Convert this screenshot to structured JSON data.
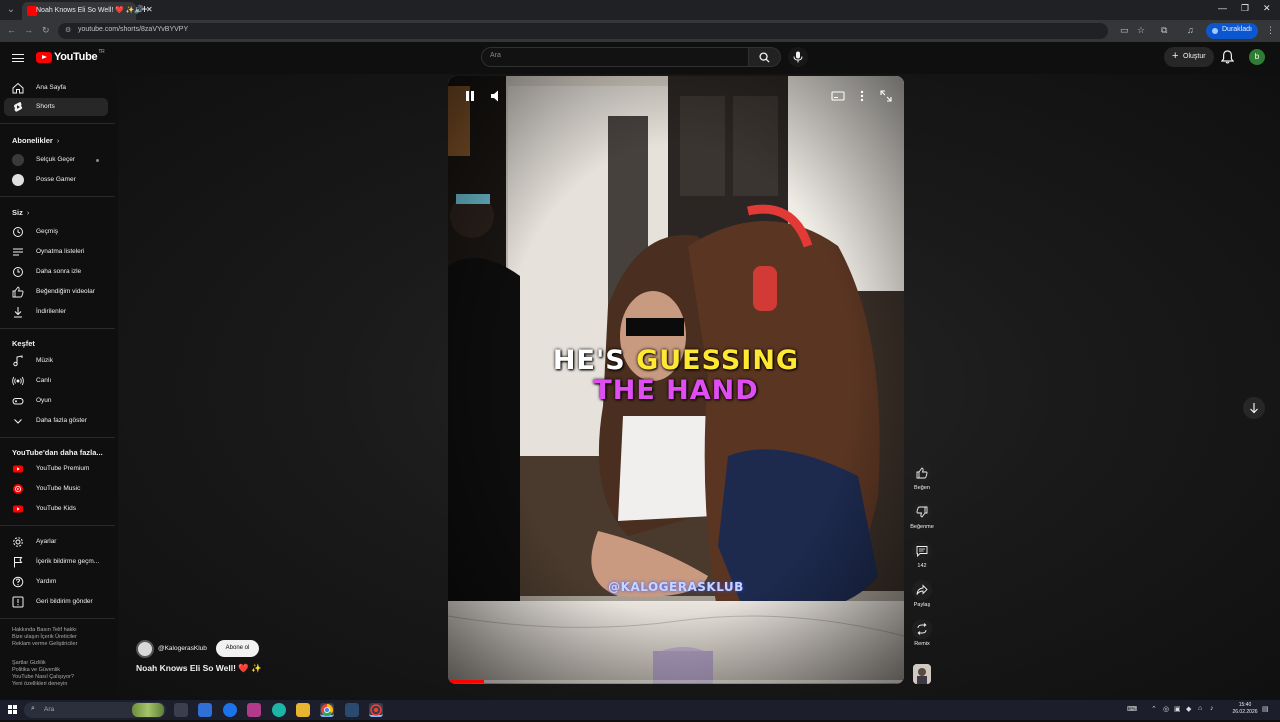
{
  "browser": {
    "tab_title": "Noah Knows Eli So Well! ❤️ ✨",
    "tab_audio_icon": "speaker-icon",
    "url": "youtube.com/shorts/8zaVYvBYVPY",
    "profile_button": "Durakladı",
    "window_controls": [
      "—",
      "❐",
      "✕"
    ]
  },
  "header": {
    "logo_text": "YouTube",
    "logo_country": "TR",
    "search_placeholder": "Ara",
    "create_label": "Oluştur",
    "avatar_letter": "b"
  },
  "sidebar": {
    "main": [
      {
        "label": "Ana Sayfa",
        "icon": "home-icon"
      },
      {
        "label": "Shorts",
        "icon": "shorts-icon",
        "active": true
      }
    ],
    "subscriptions_heading": "Abonelikler",
    "subscriptions": [
      {
        "label": "Selçuk Geçer",
        "color": "#3a3a3a"
      },
      {
        "label": "Posse Gamer",
        "color": "#e0e0e0"
      }
    ],
    "you_heading": "Siz",
    "you": [
      {
        "label": "Geçmiş",
        "icon": "history-icon"
      },
      {
        "label": "Oynatma listeleri",
        "icon": "playlist-icon"
      },
      {
        "label": "Daha sonra izle",
        "icon": "clock-icon"
      },
      {
        "label": "Beğendiğim videolar",
        "icon": "thumbs-up-icon"
      },
      {
        "label": "İndirilenler",
        "icon": "download-icon"
      }
    ],
    "explore_heading": "Keşfet",
    "explore": [
      {
        "label": "Müzik",
        "icon": "music-icon"
      },
      {
        "label": "Canlı",
        "icon": "live-icon"
      },
      {
        "label": "Oyun",
        "icon": "gaming-icon"
      },
      {
        "label": "Daha fazla göster",
        "icon": "chevron-down-icon"
      }
    ],
    "more_heading": "YouTube'dan daha fazla...",
    "more": [
      {
        "label": "YouTube Premium"
      },
      {
        "label": "YouTube Music"
      },
      {
        "label": "YouTube Kids"
      }
    ],
    "settings": [
      {
        "label": "Ayarlar",
        "icon": "gear-icon"
      },
      {
        "label": "İçerik bildirme geçm...",
        "icon": "flag-icon"
      },
      {
        "label": "Yardım",
        "icon": "help-icon"
      },
      {
        "label": "Geri bildirim gönder",
        "icon": "feedback-icon"
      }
    ],
    "footer_1": "Hakkında  Basın  Telif hakkı\nBize ulaşın  İçerik Üreticiler\nReklam verme  Geliştiriciler",
    "footer_2": "Şartlar  Gizlilik\nPolitika ve Güvenlik\nYouTube Nasıl Çalışıyor?\nYeni özellikleri deneyin"
  },
  "video": {
    "caption_line1_white": "HE'S ",
    "caption_line1_yellow": "GUESSING",
    "caption_line2": "THE HAND",
    "watermark": "@KALOGERASKLUB",
    "progress_fraction": 0.08,
    "channel": "@KalogerasKlub",
    "subscribe_label": "Abone ol",
    "title": "Noah Knows Eli So Well! ❤️ ✨"
  },
  "actions": {
    "like_label": "Beğen",
    "dislike_label": "Beğenme",
    "comments_count": "142",
    "share_label": "Paylaş",
    "remix_label": "Remix"
  },
  "taskbar": {
    "search_placeholder": "Ara",
    "time": "15:40",
    "date": "26.02.2026"
  }
}
